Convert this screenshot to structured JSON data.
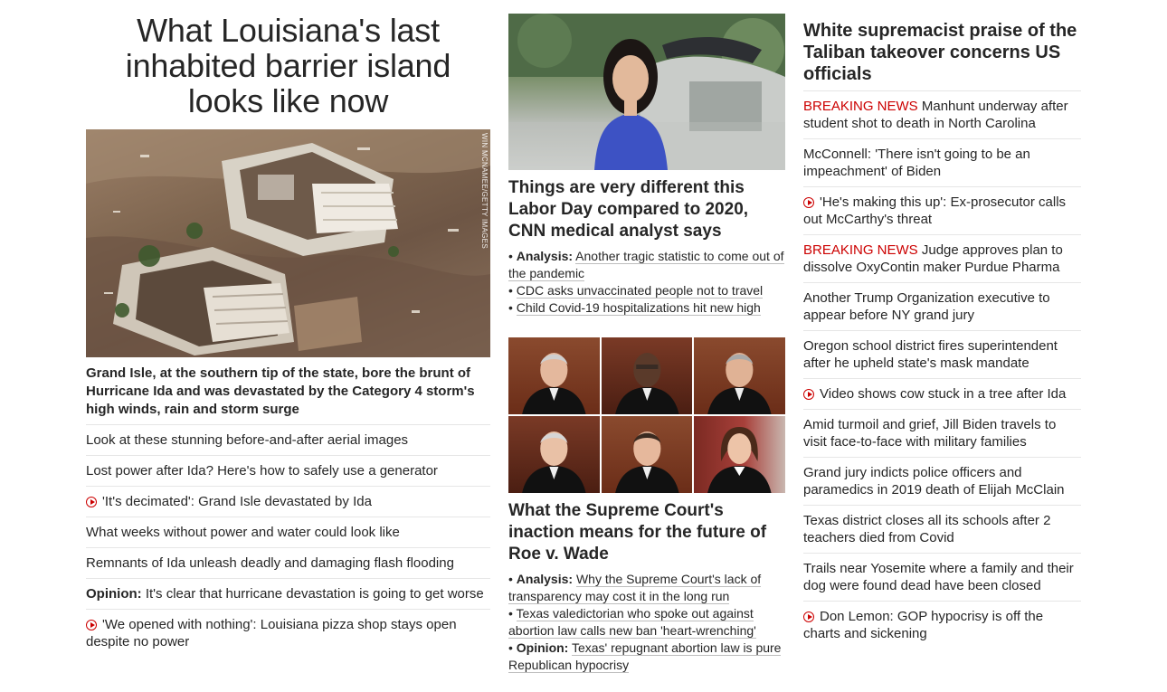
{
  "col1": {
    "headline": "What Louisiana's last inhabited barrier island looks like now",
    "image_credit": "WIN MCNAMEE/GETTY IMAGES",
    "caption": "Grand Isle, at the southern tip of the state, bore the brunt of Hurricane Ida and was devastated by the Category 4 storm's high winds, rain and storm surge",
    "items": [
      {
        "text": "Look at these stunning before-and-after aerial images"
      },
      {
        "text": "Lost power after Ida? Here's how to safely use a generator"
      },
      {
        "text": "'It's decimated': Grand Isle devastated by Ida",
        "video": true
      },
      {
        "text": "What weeks without power and water could look like"
      },
      {
        "text": "Remnants of Ida unleash deadly and damaging flash flooding"
      },
      {
        "prefix": "Opinion:",
        "text": " It's clear that hurricane devastation is going to get worse"
      },
      {
        "text": "'We opened with nothing': Louisiana pizza shop stays open despite no power",
        "video": true
      }
    ]
  },
  "col2": {
    "story1": {
      "title": "Things are very different this Labor Day compared to 2020, CNN medical analyst says",
      "bullets": [
        {
          "prefix": "Analysis:",
          "text": "Another tragic statistic to come out of the pandemic"
        },
        {
          "text": "CDC asks unvaccinated people not to travel"
        },
        {
          "text": "Child Covid-19 hospitalizations hit new high"
        }
      ]
    },
    "story2": {
      "title": "What the Supreme Court's inaction means for the future of Roe v. Wade",
      "bullets": [
        {
          "prefix": "Analysis:",
          "text": "Why the Supreme Court's lack of transparency may cost it in the long run"
        },
        {
          "text": "Texas valedictorian who spoke out against abortion law calls new ban 'heart-wrenching'"
        },
        {
          "prefix": "Opinion:",
          "text": "Texas' repugnant abortion law is pure Republican hypocrisy"
        }
      ]
    }
  },
  "col3": {
    "headline": "White supremacist praise of the Taliban takeover concerns US officials",
    "items": [
      {
        "breaking": "BREAKING NEWS",
        "text": " Manhunt underway after student shot to death in North Carolina"
      },
      {
        "text": "McConnell: 'There isn't going to be an impeachment' of Biden"
      },
      {
        "text": "'He's making this up': Ex-prosecutor calls out McCarthy's threat",
        "video": true
      },
      {
        "breaking": "BREAKING NEWS",
        "text": " Judge approves plan to dissolve OxyContin maker Purdue Pharma"
      },
      {
        "text": "Another Trump Organization executive to appear before NY grand jury"
      },
      {
        "text": "Oregon school district fires superintendent after he upheld state's mask mandate"
      },
      {
        "text": "Video shows cow stuck in a tree after Ida",
        "video": true
      },
      {
        "text": "Amid turmoil and grief, Jill Biden travels to visit face-to-face with military families"
      },
      {
        "text": "Grand jury indicts police officers and paramedics in 2019 death of Elijah McClain"
      },
      {
        "text": "Texas district closes all its schools after 2 teachers died from Covid"
      },
      {
        "text": "Trails near Yosemite where a family and their dog were found dead have been closed"
      },
      {
        "text": "Don Lemon: GOP hypocrisy is off the charts and sickening",
        "video": true
      }
    ]
  },
  "colors": {
    "breaking": "#cc0000",
    "text": "#262626",
    "divider": "#e6e6e6"
  }
}
